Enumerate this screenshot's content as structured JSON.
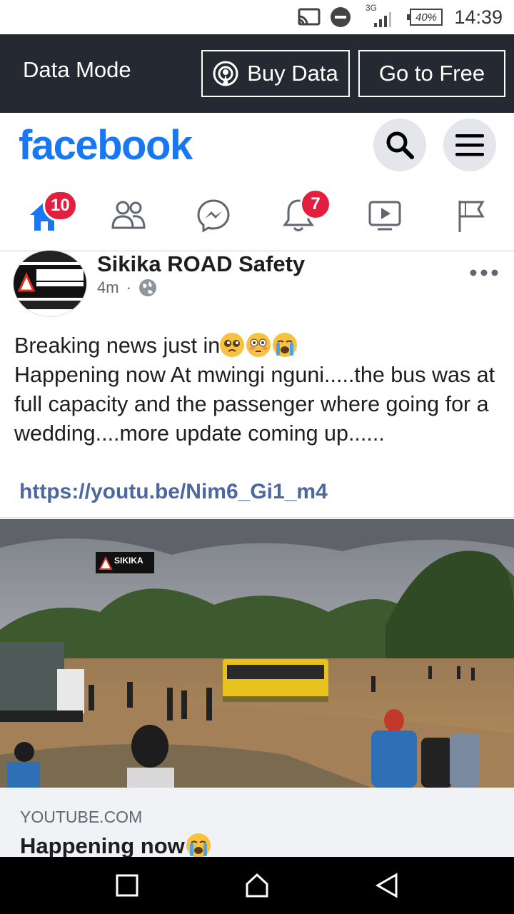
{
  "status_bar": {
    "network": "3G",
    "battery": "40%",
    "time": "14:39"
  },
  "data_bar": {
    "label": "Data Mode",
    "buy_label": "Buy Data",
    "free_label": "Go to Free"
  },
  "header": {
    "logo": "facebook",
    "accent": "#1877f2"
  },
  "nav": {
    "home_badge": "10",
    "notifications_badge": "7"
  },
  "post": {
    "page_name": "Sikika ROAD Safety",
    "time": "4m",
    "separator": "·",
    "line1": "Breaking news just in",
    "line2": "Happening now At mwingi nguni.....the bus was at full capacity and the passenger where going for a wedding....more update coming up......",
    "link": "https://youtu.be/Nim6_Gi1_m4"
  },
  "link_card": {
    "domain": "YOUTUBE.COM",
    "title": "Happening now"
  },
  "image_watermark": "SIKIKA"
}
